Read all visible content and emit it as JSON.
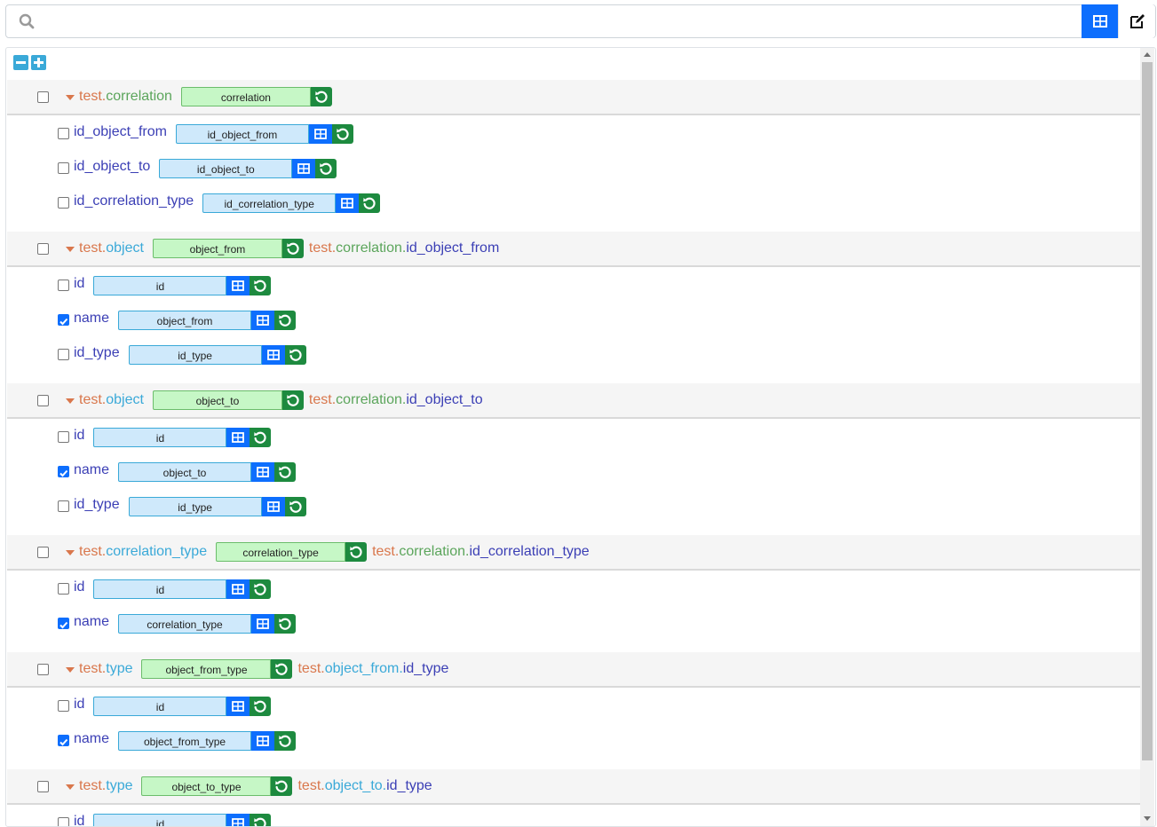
{
  "search": {
    "placeholder": "",
    "value": ""
  },
  "toolbar": {
    "table_view": "table-icon",
    "edit": "edit-icon"
  },
  "controls": {
    "collapse_all": "minus-icon",
    "expand_all": "plus-icon"
  },
  "groups": [
    {
      "schema": "test",
      "table": "correlation",
      "alias": "correlation",
      "join": null,
      "fields": [
        {
          "name": "id_object_from",
          "alias": "id_object_from",
          "checked": false
        },
        {
          "name": "id_object_to",
          "alias": "id_object_to",
          "checked": false
        },
        {
          "name": "id_correlation_type",
          "alias": "id_correlation_type",
          "checked": false
        }
      ]
    },
    {
      "schema": "test",
      "table": "object",
      "alias": "object_from",
      "join": {
        "schema": "test",
        "table": "correlation",
        "field": "id_object_from"
      },
      "fields": [
        {
          "name": "id",
          "alias": "id",
          "checked": false
        },
        {
          "name": "name",
          "alias": "object_from",
          "checked": true
        },
        {
          "name": "id_type",
          "alias": "id_type",
          "checked": false
        }
      ]
    },
    {
      "schema": "test",
      "table": "object",
      "alias": "object_to",
      "join": {
        "schema": "test",
        "table": "correlation",
        "field": "id_object_to"
      },
      "fields": [
        {
          "name": "id",
          "alias": "id",
          "checked": false
        },
        {
          "name": "name",
          "alias": "object_to",
          "checked": true
        },
        {
          "name": "id_type",
          "alias": "id_type",
          "checked": false
        }
      ]
    },
    {
      "schema": "test",
      "table": "correlation_type",
      "alias": "correlation_type",
      "join": {
        "schema": "test",
        "table": "correlation",
        "field": "id_correlation_type"
      },
      "fields": [
        {
          "name": "id",
          "alias": "id",
          "checked": false
        },
        {
          "name": "name",
          "alias": "correlation_type",
          "checked": true
        }
      ]
    },
    {
      "schema": "test",
      "table": "type",
      "alias": "object_from_type",
      "join": {
        "schema": "test",
        "table": "object_from",
        "field": "id_type"
      },
      "fields": [
        {
          "name": "id",
          "alias": "id",
          "checked": false
        },
        {
          "name": "name",
          "alias": "object_from_type",
          "checked": true
        }
      ]
    },
    {
      "schema": "test",
      "table": "type",
      "alias": "object_to_type",
      "join": {
        "schema": "test",
        "table": "object_to",
        "field": "id_type"
      },
      "fields": [
        {
          "name": "id",
          "alias": "id",
          "checked": false
        }
      ]
    }
  ]
}
